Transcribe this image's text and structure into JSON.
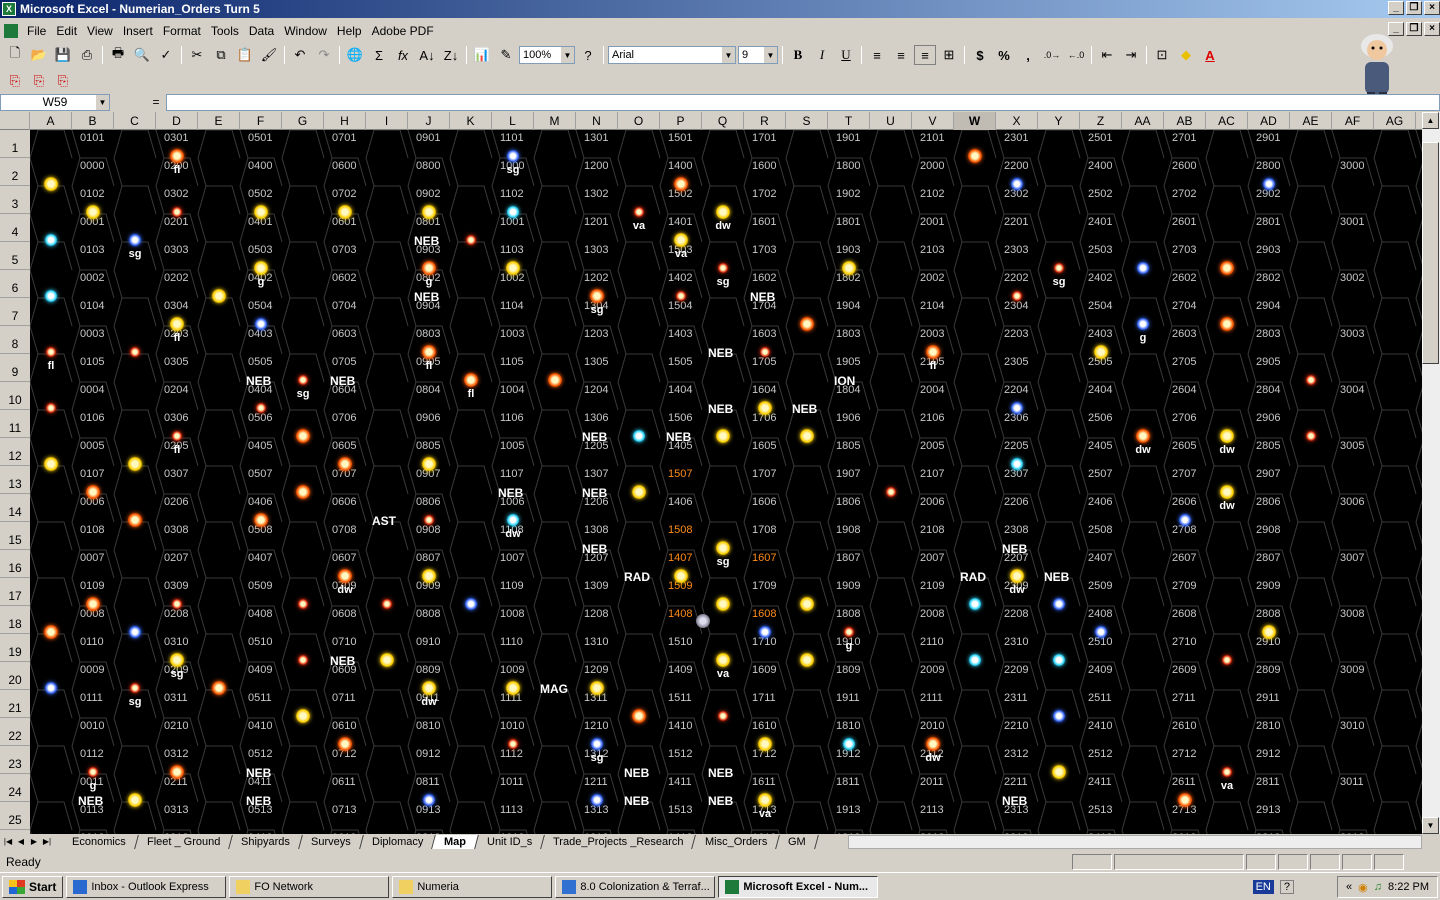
{
  "window": {
    "title": "Microsoft Excel - Numerian_Orders Turn 5",
    "icon": "excel-icon"
  },
  "menu": [
    "File",
    "Edit",
    "View",
    "Insert",
    "Format",
    "Tools",
    "Data",
    "Window",
    "Help",
    "Adobe PDF"
  ],
  "toolbar": {
    "zoom": "100%",
    "font": "Arial",
    "size": "9",
    "bold": "B",
    "italic": "I",
    "underline": "U",
    "currency": "$",
    "percent": "%",
    "comma": ","
  },
  "formula": {
    "cell": "W59",
    "eq": "=",
    "value": ""
  },
  "columns": [
    "A",
    "B",
    "C",
    "D",
    "E",
    "F",
    "G",
    "H",
    "I",
    "J",
    "K",
    "L",
    "M",
    "N",
    "O",
    "P",
    "Q",
    "R",
    "S",
    "T",
    "U",
    "V",
    "W",
    "X",
    "Y",
    "Z",
    "AA",
    "AB",
    "AC",
    "AD",
    "AE",
    "AF",
    "AG"
  ],
  "active_column": "W",
  "rows": [
    "1",
    "2",
    "3",
    "4",
    "5",
    "6",
    "7",
    "8",
    "9",
    "10",
    "11",
    "12",
    "13",
    "14",
    "15",
    "16",
    "17",
    "18",
    "19",
    "20",
    "21",
    "22",
    "23",
    "24",
    "25"
  ],
  "hex_highlight": [
    "1507",
    "1407",
    "1607",
    "1508",
    "1408",
    "1608",
    "1509"
  ],
  "stars": [
    {
      "c": 3,
      "r": 0,
      "t": "o",
      "l": "fl"
    },
    {
      "c": 11,
      "r": 0,
      "t": "b",
      "l": "sg"
    },
    {
      "c": 22,
      "r": 0,
      "t": "o",
      "l": ""
    },
    {
      "c": 0,
      "r": 1,
      "t": "y",
      "l": ""
    },
    {
      "c": 15,
      "r": 1,
      "t": "o",
      "l": ""
    },
    {
      "c": 23,
      "r": 1,
      "t": "b",
      "l": ""
    },
    {
      "c": 29,
      "r": 1,
      "t": "b",
      "l": ""
    },
    {
      "c": 1,
      "r": 2,
      "t": "y",
      "l": ""
    },
    {
      "c": 3,
      "r": 2,
      "t": "r",
      "l": ""
    },
    {
      "c": 5,
      "r": 2,
      "t": "y",
      "l": ""
    },
    {
      "c": 7,
      "r": 2,
      "t": "y",
      "l": ""
    },
    {
      "c": 9,
      "r": 2,
      "t": "y",
      "l": ""
    },
    {
      "c": 11,
      "r": 2,
      "t": "c",
      "l": ""
    },
    {
      "c": 14,
      "r": 2,
      "t": "r",
      "l": "va"
    },
    {
      "c": 16,
      "r": 2,
      "t": "y",
      "l": "dw"
    },
    {
      "c": 0,
      "r": 3,
      "t": "c",
      "l": ""
    },
    {
      "c": 2,
      "r": 3,
      "t": "b",
      "l": "sg"
    },
    {
      "c": 10,
      "r": 3,
      "t": "r",
      "l": ""
    },
    {
      "c": 15,
      "r": 3,
      "t": "y",
      "l": "va"
    },
    {
      "c": 5,
      "r": 4,
      "t": "y",
      "l": "g"
    },
    {
      "c": 9,
      "r": 4,
      "t": "o",
      "l": "g"
    },
    {
      "c": 11,
      "r": 4,
      "t": "y",
      "l": ""
    },
    {
      "c": 16,
      "r": 4,
      "t": "r",
      "l": "sg"
    },
    {
      "c": 19,
      "r": 4,
      "t": "y",
      "l": ""
    },
    {
      "c": 24,
      "r": 4,
      "t": "r",
      "l": "sg"
    },
    {
      "c": 26,
      "r": 4,
      "t": "b",
      "l": ""
    },
    {
      "c": 28,
      "r": 4,
      "t": "o",
      "l": ""
    },
    {
      "c": 0,
      "r": 5,
      "t": "c",
      "l": ""
    },
    {
      "c": 4,
      "r": 5,
      "t": "y",
      "l": ""
    },
    {
      "c": 13,
      "r": 5,
      "t": "o",
      "l": "sg"
    },
    {
      "c": 15,
      "r": 5,
      "t": "r",
      "l": ""
    },
    {
      "c": 23,
      "r": 5,
      "t": "r",
      "l": ""
    },
    {
      "c": 3,
      "r": 6,
      "t": "y",
      "l": "fl"
    },
    {
      "c": 5,
      "r": 6,
      "t": "b",
      "l": ""
    },
    {
      "c": 18,
      "r": 6,
      "t": "o",
      "l": ""
    },
    {
      "c": 26,
      "r": 6,
      "t": "b",
      "l": "g"
    },
    {
      "c": 28,
      "r": 6,
      "t": "o",
      "l": ""
    },
    {
      "c": 0,
      "r": 7,
      "t": "r",
      "l": "fl"
    },
    {
      "c": 2,
      "r": 7,
      "t": "r",
      "l": ""
    },
    {
      "c": 9,
      "r": 7,
      "t": "o",
      "l": "fl"
    },
    {
      "c": 17,
      "r": 7,
      "t": "r",
      "l": ""
    },
    {
      "c": 21,
      "r": 7,
      "t": "o",
      "l": "fl"
    },
    {
      "c": 25,
      "r": 7,
      "t": "y",
      "l": ""
    },
    {
      "c": 6,
      "r": 8,
      "t": "r",
      "l": "sg"
    },
    {
      "c": 10,
      "r": 8,
      "t": "o",
      "l": "fl"
    },
    {
      "c": 12,
      "r": 8,
      "t": "o",
      "l": ""
    },
    {
      "c": 30,
      "r": 8,
      "t": "r",
      "l": ""
    },
    {
      "c": 0,
      "r": 9,
      "t": "r",
      "l": ""
    },
    {
      "c": 5,
      "r": 9,
      "t": "r",
      "l": ""
    },
    {
      "c": 17,
      "r": 9,
      "t": "y",
      "l": ""
    },
    {
      "c": 23,
      "r": 9,
      "t": "b",
      "l": ""
    },
    {
      "c": 3,
      "r": 10,
      "t": "r",
      "l": "fl"
    },
    {
      "c": 6,
      "r": 10,
      "t": "o",
      "l": ""
    },
    {
      "c": 14,
      "r": 10,
      "t": "c",
      "l": ""
    },
    {
      "c": 16,
      "r": 10,
      "t": "y",
      "l": ""
    },
    {
      "c": 18,
      "r": 10,
      "t": "y",
      "l": ""
    },
    {
      "c": 26,
      "r": 10,
      "t": "o",
      "l": "dw"
    },
    {
      "c": 28,
      "r": 10,
      "t": "y",
      "l": "dw"
    },
    {
      "c": 30,
      "r": 10,
      "t": "r",
      "l": ""
    },
    {
      "c": 0,
      "r": 11,
      "t": "y",
      "l": ""
    },
    {
      "c": 2,
      "r": 11,
      "t": "y",
      "l": ""
    },
    {
      "c": 7,
      "r": 11,
      "t": "o",
      "l": ""
    },
    {
      "c": 9,
      "r": 11,
      "t": "y",
      "l": ""
    },
    {
      "c": 23,
      "r": 11,
      "t": "c",
      "l": ""
    },
    {
      "c": 1,
      "r": 12,
      "t": "o",
      "l": ""
    },
    {
      "c": 6,
      "r": 12,
      "t": "o",
      "l": ""
    },
    {
      "c": 14,
      "r": 12,
      "t": "y",
      "l": ""
    },
    {
      "c": 20,
      "r": 12,
      "t": "r",
      "l": ""
    },
    {
      "c": 28,
      "r": 12,
      "t": "y",
      "l": "dw"
    },
    {
      "c": 2,
      "r": 13,
      "t": "o",
      "l": ""
    },
    {
      "c": 5,
      "r": 13,
      "t": "o",
      "l": ""
    },
    {
      "c": 9,
      "r": 13,
      "t": "r",
      "l": ""
    },
    {
      "c": 11,
      "r": 13,
      "t": "c",
      "l": "dw"
    },
    {
      "c": 27,
      "r": 13,
      "t": "b",
      "l": ""
    },
    {
      "c": 16,
      "r": 14,
      "t": "y",
      "l": "sg"
    },
    {
      "c": 7,
      "r": 15,
      "t": "o",
      "l": "dw"
    },
    {
      "c": 9,
      "r": 15,
      "t": "y",
      "l": ""
    },
    {
      "c": 15,
      "r": 15,
      "t": "y",
      "l": ""
    },
    {
      "c": 23,
      "r": 15,
      "t": "y",
      "l": "dw"
    },
    {
      "c": 1,
      "r": 16,
      "t": "o",
      "l": ""
    },
    {
      "c": 3,
      "r": 16,
      "t": "r",
      "l": ""
    },
    {
      "c": 6,
      "r": 16,
      "t": "r",
      "l": ""
    },
    {
      "c": 8,
      "r": 16,
      "t": "r",
      "l": ""
    },
    {
      "c": 10,
      "r": 16,
      "t": "b",
      "l": ""
    },
    {
      "c": 16,
      "r": 16,
      "t": "y",
      "l": ""
    },
    {
      "c": 18,
      "r": 16,
      "t": "y",
      "l": ""
    },
    {
      "c": 22,
      "r": 16,
      "t": "c",
      "l": ""
    },
    {
      "c": 24,
      "r": 16,
      "t": "b",
      "l": ""
    },
    {
      "c": 0,
      "r": 17,
      "t": "o",
      "l": ""
    },
    {
      "c": 2,
      "r": 17,
      "t": "b",
      "l": ""
    },
    {
      "c": 17,
      "r": 17,
      "t": "b",
      "l": ""
    },
    {
      "c": 19,
      "r": 17,
      "t": "r",
      "l": "g"
    },
    {
      "c": 25,
      "r": 17,
      "t": "b",
      "l": ""
    },
    {
      "c": 29,
      "r": 17,
      "t": "y",
      "l": ""
    },
    {
      "c": 3,
      "r": 18,
      "t": "y",
      "l": "sg"
    },
    {
      "c": 6,
      "r": 18,
      "t": "r",
      "l": ""
    },
    {
      "c": 8,
      "r": 18,
      "t": "y",
      "l": ""
    },
    {
      "c": 16,
      "r": 18,
      "t": "y",
      "l": "va"
    },
    {
      "c": 18,
      "r": 18,
      "t": "y",
      "l": ""
    },
    {
      "c": 22,
      "r": 18,
      "t": "c",
      "l": ""
    },
    {
      "c": 24,
      "r": 18,
      "t": "c",
      "l": ""
    },
    {
      "c": 28,
      "r": 18,
      "t": "r",
      "l": ""
    },
    {
      "c": 0,
      "r": 19,
      "t": "b",
      "l": ""
    },
    {
      "c": 2,
      "r": 19,
      "t": "r",
      "l": "sg"
    },
    {
      "c": 4,
      "r": 19,
      "t": "o",
      "l": ""
    },
    {
      "c": 9,
      "r": 19,
      "t": "y",
      "l": "dw"
    },
    {
      "c": 11,
      "r": 19,
      "t": "y",
      "l": ""
    },
    {
      "c": 13,
      "r": 19,
      "t": "y",
      "l": ""
    },
    {
      "c": 6,
      "r": 20,
      "t": "y",
      "l": ""
    },
    {
      "c": 14,
      "r": 20,
      "t": "o",
      "l": ""
    },
    {
      "c": 16,
      "r": 20,
      "t": "r",
      "l": ""
    },
    {
      "c": 24,
      "r": 20,
      "t": "b",
      "l": ""
    },
    {
      "c": 7,
      "r": 21,
      "t": "o",
      "l": ""
    },
    {
      "c": 11,
      "r": 21,
      "t": "r",
      "l": ""
    },
    {
      "c": 13,
      "r": 21,
      "t": "b",
      "l": "sg"
    },
    {
      "c": 17,
      "r": 21,
      "t": "y",
      "l": ""
    },
    {
      "c": 19,
      "r": 21,
      "t": "c",
      "l": ""
    },
    {
      "c": 21,
      "r": 21,
      "t": "o",
      "l": "dw"
    },
    {
      "c": 1,
      "r": 22,
      "t": "r",
      "l": "g"
    },
    {
      "c": 3,
      "r": 22,
      "t": "o",
      "l": ""
    },
    {
      "c": 24,
      "r": 22,
      "t": "y",
      "l": ""
    },
    {
      "c": 28,
      "r": 22,
      "t": "r",
      "l": "va"
    },
    {
      "c": 2,
      "r": 23,
      "t": "y",
      "l": ""
    },
    {
      "c": 9,
      "r": 23,
      "t": "b",
      "l": ""
    },
    {
      "c": 13,
      "r": 23,
      "t": "b",
      "l": ""
    },
    {
      "c": 17,
      "r": 23,
      "t": "y",
      "l": "va"
    },
    {
      "c": 27,
      "r": 23,
      "t": "o",
      "l": ""
    }
  ],
  "nebulae": [
    {
      "c": 9,
      "r": 3,
      "t": "NEB"
    },
    {
      "c": 9,
      "r": 5,
      "t": "NEB"
    },
    {
      "c": 17,
      "r": 5,
      "t": "NEB"
    },
    {
      "c": 16,
      "r": 7,
      "t": "NEB"
    },
    {
      "c": 5,
      "r": 8,
      "t": "NEB"
    },
    {
      "c": 7,
      "r": 8,
      "t": "NEB"
    },
    {
      "c": 19,
      "r": 8,
      "t": "ION"
    },
    {
      "c": 16,
      "r": 9,
      "t": "NEB"
    },
    {
      "c": 18,
      "r": 9,
      "t": "NEB"
    },
    {
      "c": 13,
      "r": 10,
      "t": "NEB"
    },
    {
      "c": 15,
      "r": 10,
      "t": "NEB"
    },
    {
      "c": 11,
      "r": 12,
      "t": "NEB"
    },
    {
      "c": 13,
      "r": 12,
      "t": "NEB"
    },
    {
      "c": 8,
      "r": 13,
      "t": "AST"
    },
    {
      "c": 13,
      "r": 14,
      "t": "NEB"
    },
    {
      "c": 23,
      "r": 14,
      "t": "NEB"
    },
    {
      "c": 14,
      "r": 15,
      "t": "RAD"
    },
    {
      "c": 22,
      "r": 15,
      "t": "RAD"
    },
    {
      "c": 24,
      "r": 15,
      "t": "NEB"
    },
    {
      "c": 7,
      "r": 18,
      "t": "NEB"
    },
    {
      "c": 12,
      "r": 19,
      "t": "MAG"
    },
    {
      "c": 5,
      "r": 22,
      "t": "NEB"
    },
    {
      "c": 1,
      "r": 23,
      "t": "NEB"
    },
    {
      "c": 5,
      "r": 23,
      "t": "NEB"
    },
    {
      "c": 14,
      "r": 23,
      "t": "NEB"
    },
    {
      "c": 16,
      "r": 23,
      "t": "NEB"
    },
    {
      "c": 14,
      "r": 22,
      "t": "NEB"
    },
    {
      "c": 16,
      "r": 22,
      "t": "NEB"
    },
    {
      "c": 23,
      "r": 23,
      "t": "NEB"
    }
  ],
  "sheets": [
    "Economics",
    "Fleet _ Ground",
    "Shipyards",
    "Surveys",
    "Diplomacy",
    "Map",
    "Unit ID_s",
    "Trade_Projects _Research",
    "Misc_Orders",
    "GM"
  ],
  "active_sheet": "Map",
  "status": "Ready",
  "taskbar": {
    "start": "Start",
    "tasks": [
      "Inbox - Outlook Express",
      "FO Network",
      "Numeria",
      "8.0 Colonization & Terraf...",
      "Microsoft Excel - Num..."
    ],
    "active": 4,
    "lang": "EN",
    "clock": "8:22 PM"
  },
  "colors": {
    "o": "#ff5a00",
    "y": "#ffd000",
    "b": "#3c6cff",
    "c": "#30d8ff",
    "r": "#e03010",
    "hl": "#ff8c1a"
  }
}
